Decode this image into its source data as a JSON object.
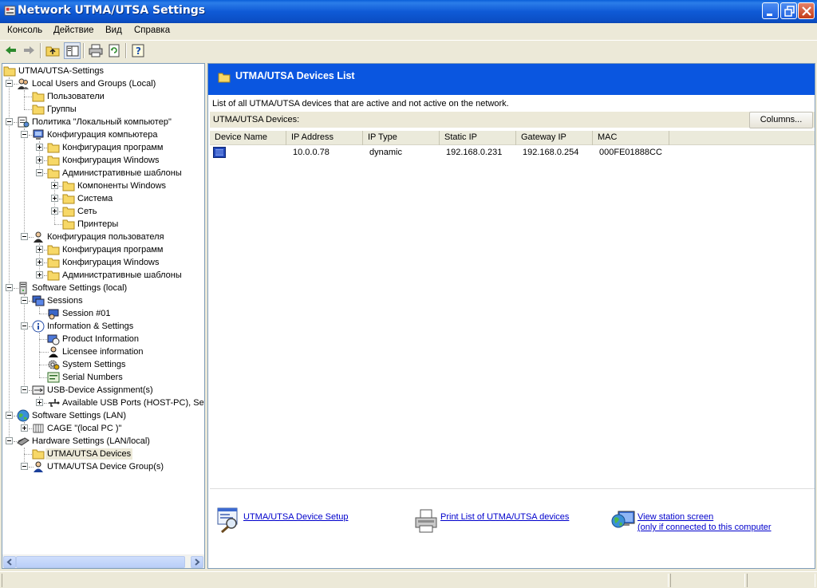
{
  "window": {
    "title": "Network UTMA/UTSA Settings"
  },
  "menu": [
    "Консоль",
    "Действие",
    "Вид",
    "Справка"
  ],
  "tree": [
    {
      "label": "UTMA/UTSA-Settings",
      "icon": "folder-icon"
    },
    {
      "label": "Local Users and Groups (Local)",
      "icon": "users-icon"
    },
    {
      "label": "Пользователи",
      "icon": "folder-icon"
    },
    {
      "label": "Группы",
      "icon": "folder-icon"
    },
    {
      "label": "Политика \"Локальный компьютер\"",
      "icon": "policy-icon"
    },
    {
      "label": "Конфигурация компьютера",
      "icon": "computer-icon"
    },
    {
      "label": "Конфигурация программ",
      "icon": "folder-icon"
    },
    {
      "label": "Конфигурация Windows",
      "icon": "folder-icon"
    },
    {
      "label": "Административные шаблоны",
      "icon": "folder-icon"
    },
    {
      "label": "Компоненты Windows",
      "icon": "folder-icon"
    },
    {
      "label": "Система",
      "icon": "folder-icon"
    },
    {
      "label": "Сеть",
      "icon": "folder-icon"
    },
    {
      "label": "Принтеры",
      "icon": "folder-icon"
    },
    {
      "label": "Конфигурация пользователя",
      "icon": "user-config-icon"
    },
    {
      "label": "Конфигурация программ",
      "icon": "folder-icon"
    },
    {
      "label": "Конфигурация Windows",
      "icon": "folder-icon"
    },
    {
      "label": "Административные шаблоны",
      "icon": "folder-icon"
    },
    {
      "label": "Software Settings (local)",
      "icon": "server-icon"
    },
    {
      "label": "Sessions",
      "icon": "sessions-icon"
    },
    {
      "label": "Session #01",
      "icon": "session-icon"
    },
    {
      "label": "Information & Settings",
      "icon": "info-icon"
    },
    {
      "label": "Product Information",
      "icon": "product-icon"
    },
    {
      "label": "Licensee information",
      "icon": "licensee-icon"
    },
    {
      "label": "System Settings",
      "icon": "gear-icon"
    },
    {
      "label": "Serial Numbers",
      "icon": "serial-icon"
    },
    {
      "label": "USB-Device Assignment(s)",
      "icon": "usb-assign-icon"
    },
    {
      "label": "Available USB Ports (HOST-PC), Sett",
      "icon": "usb-icon"
    },
    {
      "label": "Software Settings (LAN)",
      "icon": "globe-icon"
    },
    {
      "label": "CAGE \"(local PC )\"",
      "icon": "cage-icon"
    },
    {
      "label": "Hardware Settings (LAN/local)",
      "icon": "hardware-icon"
    },
    {
      "label": "UTMA/UTSA Devices",
      "icon": "folder-icon"
    },
    {
      "label": "UTMA/UTSA Device Group(s)",
      "icon": "device-group-icon"
    }
  ],
  "right": {
    "header_title": "UTMA/UTSA Devices List",
    "description": "List of all UTMA/UTSA devices that are active and not active on the network.",
    "devices_label": "UTMA/UTSA Devices:",
    "columns_button": "Columns...",
    "columns": [
      "Device Name",
      "IP Address",
      "IP Type",
      "Static IP",
      "Gateway IP",
      "MAC"
    ],
    "rows": [
      {
        "device_name": "",
        "ip_address": "10.0.0.78",
        "ip_type": "dynamic",
        "static_ip": "192.168.0.231",
        "gateway_ip": "192.168.0.254",
        "mac": "000FE01888CC"
      }
    ],
    "actions": {
      "setup": "UTMA/UTSA Device Setup",
      "print": "Print List of UTMA/UTSA devices",
      "view_line1": "View station screen",
      "view_line2": "(only if connected to this computer"
    }
  },
  "colors": {
    "header_blue": "#0a56e0",
    "link": "#0000cc",
    "titlebar": "#0b55d3"
  }
}
